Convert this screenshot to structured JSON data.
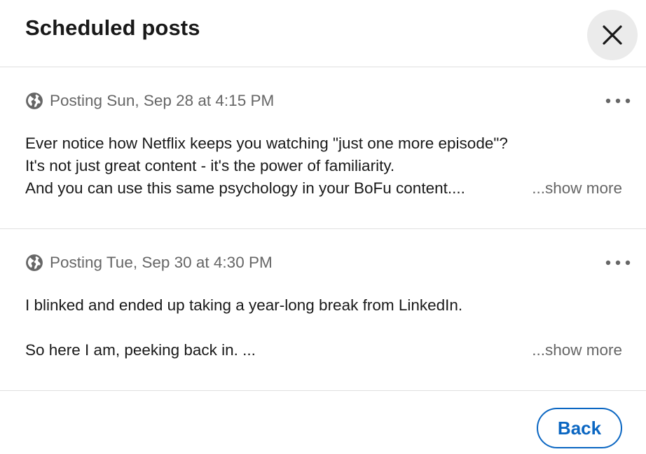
{
  "dialog": {
    "title": "Scheduled posts",
    "close_icon": "close-icon"
  },
  "posts": [
    {
      "meta": "Posting Sun, Sep 28 at 4:15 PM",
      "visibility_icon": "globe-icon",
      "more_icon": "more-horizontal-icon",
      "lines": [
        "Ever notice how Netflix keeps you watching \"just one more episode\"?",
        "It's not just great content - it's the power of familiarity.",
        "And you can use this same psychology in your BoFu content...."
      ],
      "show_more": "...show more"
    },
    {
      "meta": "Posting Tue, Sep 30 at 4:30 PM",
      "visibility_icon": "globe-icon",
      "more_icon": "more-horizontal-icon",
      "lines": [
        "I blinked and ended up taking a year-long break from LinkedIn.",
        "",
        "So here I am, peeking back in. ..."
      ],
      "show_more": "...show more"
    }
  ],
  "footer": {
    "back_label": "Back"
  },
  "colors": {
    "accent": "#0a66c2",
    "text_primary": "#191919",
    "text_secondary": "#666666",
    "divider": "#e0e0e0",
    "close_bg": "#ebebeb"
  }
}
